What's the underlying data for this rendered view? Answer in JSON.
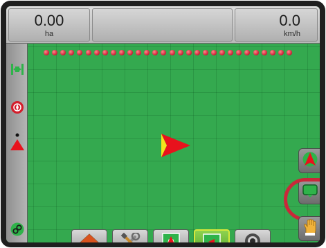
{
  "top_bar": {
    "area": {
      "value": "0.00",
      "unit": "ha"
    },
    "speed": {
      "value": "0.0",
      "unit": "km/h"
    },
    "center": ""
  },
  "boom": {
    "section_count": 30,
    "section_color": "#d1203a"
  },
  "left_sidebar": {
    "items": [
      {
        "icon": "boom-width-icon"
      },
      {
        "icon": "flow-status-icon"
      },
      {
        "icon": "marker-icon"
      },
      {
        "icon": "zoom-link-icon"
      }
    ]
  },
  "right_buttons": [
    {
      "icon": "vehicle-view-icon"
    },
    {
      "icon": "screen-view-icon",
      "highlighted": true
    },
    {
      "icon": "pan-hand-icon"
    }
  ],
  "bottom_tabs": [
    {
      "icon": "home-icon"
    },
    {
      "icon": "tools-icon"
    },
    {
      "icon": "vehicle-view-tab-icon"
    },
    {
      "icon": "map-view-tab-icon",
      "active": true
    },
    {
      "icon": "camera-icon"
    }
  ],
  "colors": {
    "field": "#34a94f",
    "vehicle": "#e8121c",
    "highlight": "#c9283a",
    "active_tab": "#56a52c"
  }
}
